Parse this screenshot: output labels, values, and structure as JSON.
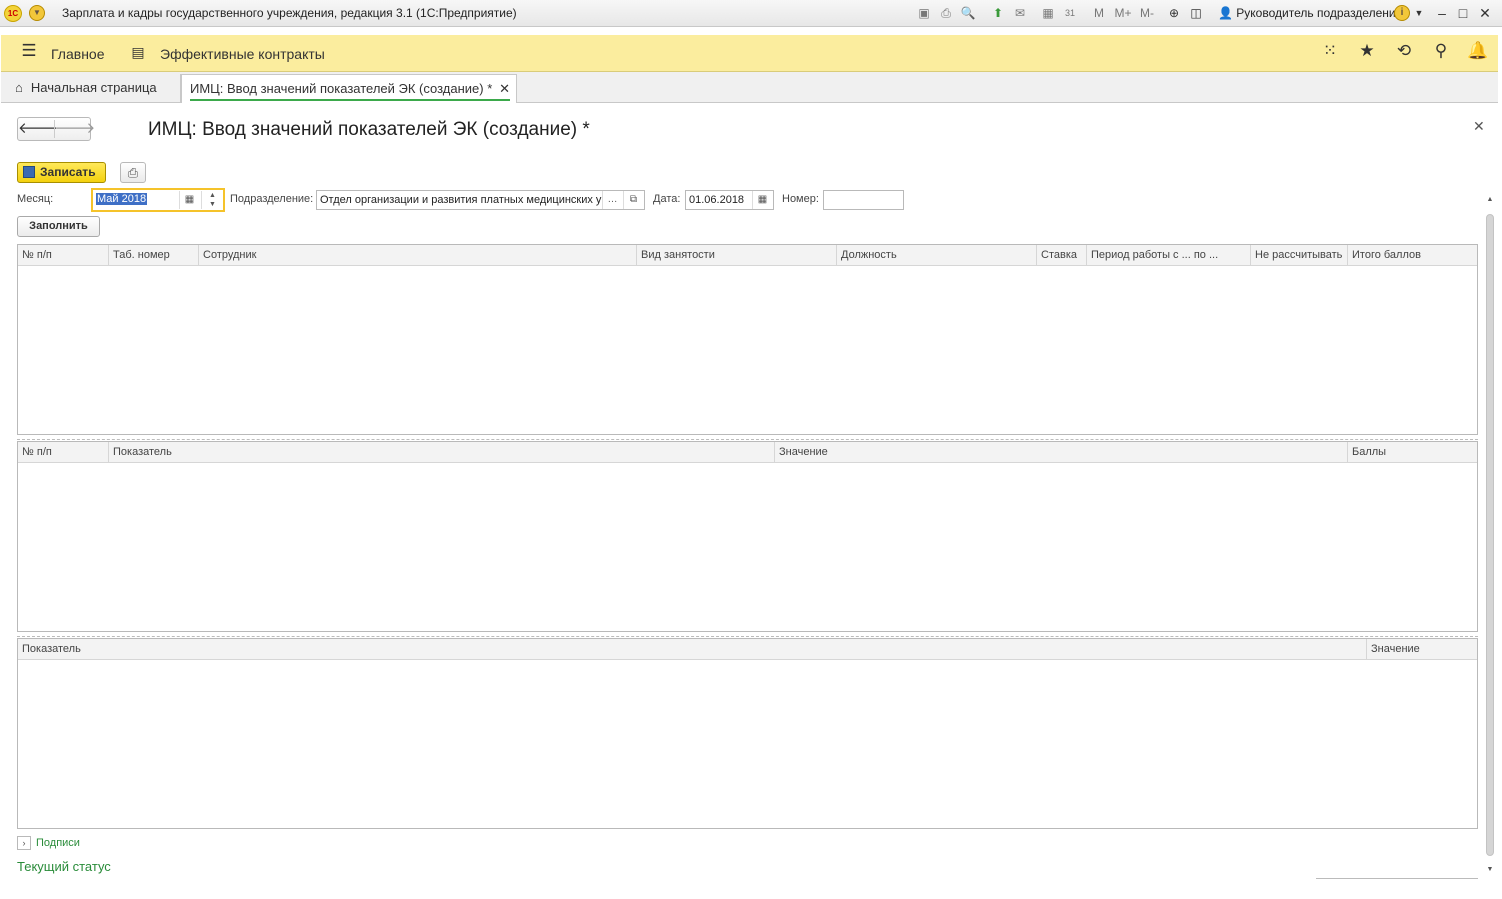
{
  "window": {
    "title": "Зарплата и кадры государственного учреждения, редакция 3.1  (1С:Предприятие)",
    "user": "Руководитель подразделения",
    "toolbar_m": [
      "M",
      "M+",
      "M-"
    ]
  },
  "sections": {
    "main": "Главное",
    "contracts": "Эффективные контракты"
  },
  "tabs": {
    "home": "Начальная страница",
    "form": "ИМЦ: Ввод значений показателей ЭК (создание) *"
  },
  "form": {
    "title": "ИМЦ: Ввод значений показателей ЭК (создание) *",
    "save_label": "Записать",
    "fill_label": "Заполнить",
    "month_label": "Месяц:",
    "month_value": "Май 2018",
    "division_label": "Подразделение:",
    "division_value": "Отдел организации и развития платных медицинских у",
    "date_label": "Дата:",
    "date_value": "01.06.2018",
    "number_label": "Номер:",
    "number_value": ""
  },
  "grid1": {
    "columns": [
      "№ п/п",
      "Таб. номер",
      "Сотрудник",
      "Вид занятости",
      "Должность",
      "Ставка",
      "Период работы с ... по ...",
      "Не рассчитывать",
      "Итого баллов"
    ]
  },
  "grid2": {
    "columns": [
      "№ п/п",
      "Показатель",
      "Значение",
      "Баллы"
    ]
  },
  "grid3": {
    "columns": [
      "Показатель",
      "Значение"
    ]
  },
  "footer": {
    "signatures": "Подписи",
    "status": "Текущий статус"
  },
  "colors": {
    "section_bar": "#fbed9e",
    "save_button": "#f4d10e",
    "accent_green": "#2a8c3a"
  }
}
